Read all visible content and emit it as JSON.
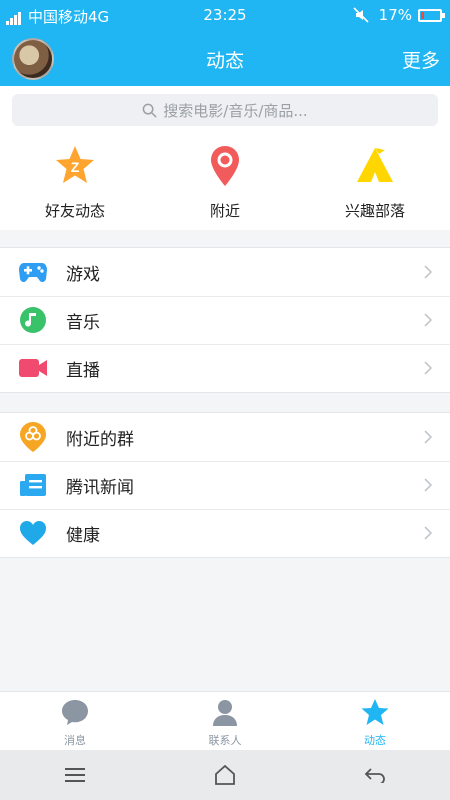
{
  "status_bar": {
    "network_type": "4G",
    "carrier": "中国移动4G",
    "time": "23:25",
    "battery": "17%",
    "battery_level_fraction": 0.17
  },
  "header": {
    "title": "动态",
    "more": "更多"
  },
  "search": {
    "placeholder": "搜索电影/音乐/商品..."
  },
  "shortcuts": [
    {
      "label": "好友动态",
      "icon": "star-z-icon",
      "color": "#ffa42e"
    },
    {
      "label": "附近",
      "icon": "location-pin-icon",
      "color": "#f25b5b"
    },
    {
      "label": "兴趣部落",
      "icon": "tent-icon",
      "color": "#ffd600"
    }
  ],
  "list_group_1": [
    {
      "label": "游戏",
      "icon": "gamepad-icon",
      "color": "#2f9ef2"
    },
    {
      "label": "音乐",
      "icon": "music-note-icon",
      "color": "#39c26a"
    },
    {
      "label": "直播",
      "icon": "video-camera-icon",
      "color": "#f04b6e"
    }
  ],
  "list_group_2": [
    {
      "label": "附近的群",
      "icon": "nearby-group-icon",
      "color": "#f6a623"
    },
    {
      "label": "腾讯新闻",
      "icon": "news-icon",
      "color": "#2aa8f0"
    },
    {
      "label": "健康",
      "icon": "heart-icon",
      "color": "#20a9e8"
    }
  ],
  "tabbar": [
    {
      "label": "消息",
      "icon": "chat-bubble-icon"
    },
    {
      "label": "联系人",
      "icon": "contact-person-icon"
    },
    {
      "label": "动态",
      "icon": "star-icon",
      "active": true
    }
  ],
  "colors": {
    "accent": "#1fb6f3",
    "background": "#f4f5f7",
    "inactive_tab": "#8c96a3"
  }
}
